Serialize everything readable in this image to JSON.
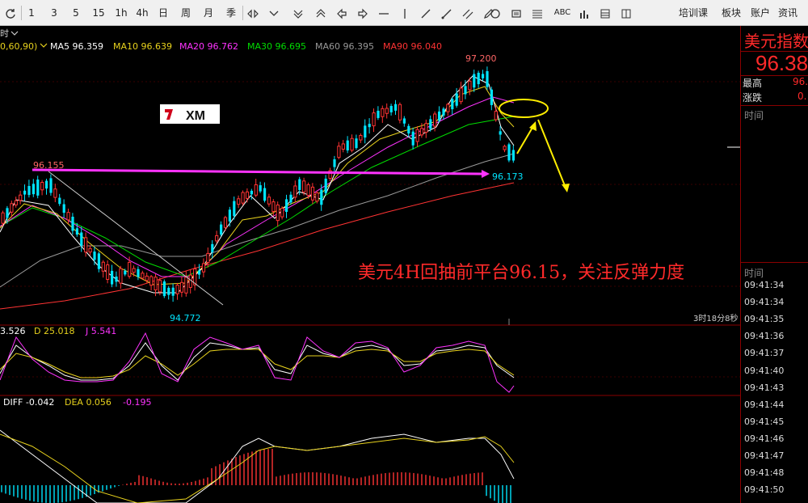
{
  "toolbar": {
    "items": [
      "1",
      "3",
      "5",
      "15",
      "1h",
      "4h",
      "日",
      "周",
      "月",
      "季"
    ],
    "right_items": [
      "培训课",
      "板块",
      "账户",
      "资讯"
    ],
    "abc_label": "ABC"
  },
  "chart": {
    "period_label": "时",
    "ma_legend": [
      {
        "label": "MA5 96.359",
        "color": "#ffffff"
      },
      {
        "label": "MA10 96.639",
        "color": "#e8d21d"
      },
      {
        "label": "MA20 96.762",
        "color": "#ff33ff"
      },
      {
        "label": "MA30 96.695",
        "color": "#00dd00"
      },
      {
        "label": "MA60 96.395",
        "color": "#999999"
      },
      {
        "label": "MA90 96.040",
        "color": "#ff3333"
      }
    ],
    "ma_params": "0,60,90)",
    "high_label": "97.200",
    "low_label": "94.772",
    "prev_level_label": "96.155",
    "current_level_label": "96.173",
    "annotation": "美元4H回抽前平台96.15，关注反弹力度",
    "countdown": "3时18分8秒",
    "logo_text": "XM"
  },
  "kdj": {
    "k_label": "3.526",
    "d_label": "D 25.018",
    "j_label": "J 5.541"
  },
  "macd": {
    "diff_label": "DIFF -0.042",
    "dea_label": "DEA 0.056",
    "macd_label": "-0.195"
  },
  "sidebar": {
    "title": "美元指数",
    "price": "96.38",
    "high_label": "最高",
    "high_value": "96.",
    "change_label": "涨跌",
    "change_value": "0.",
    "time_header_top": "时间",
    "time_header": "时间",
    "times": [
      "09:41:34",
      "09:41:34",
      "09:41:35",
      "09:41:36",
      "09:41:37",
      "09:41:40",
      "09:41:43",
      "09:41:44",
      "09:41:45",
      "09:41:46",
      "09:41:47",
      "09:41:48",
      "09:41:50"
    ]
  },
  "colors": {
    "up": "#ff3333",
    "down": "#00e5ff",
    "accent_red": "#ff2a2a",
    "purple_arrow": "#ff33ff",
    "yellow_arrow": "#ffee00"
  }
}
